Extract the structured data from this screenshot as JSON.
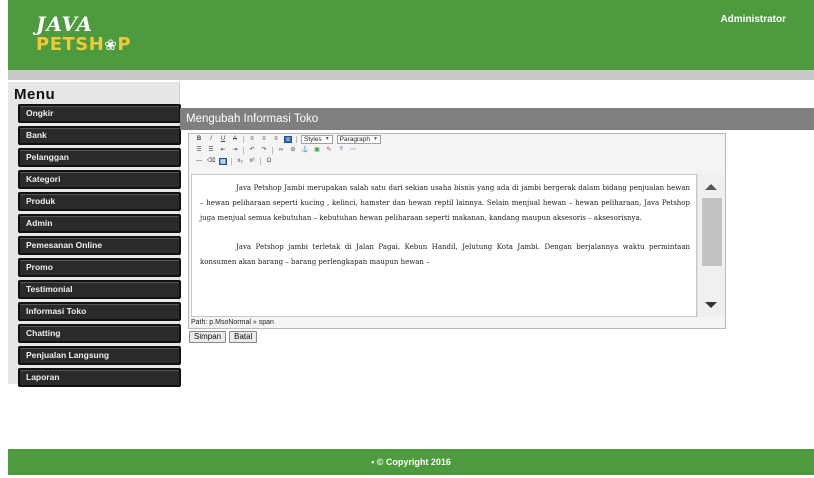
{
  "header": {
    "logo_line1": "JAVA",
    "logo_line2_left": "PETSH",
    "logo_line2_right": "P",
    "admin": "Administrator"
  },
  "sidebar": {
    "title": "Menu",
    "items": [
      {
        "label": "Ongkir"
      },
      {
        "label": "Bank"
      },
      {
        "label": "Pelanggan"
      },
      {
        "label": "Kategori"
      },
      {
        "label": "Produk"
      },
      {
        "label": "Admin"
      },
      {
        "label": "Pemesanan Online"
      },
      {
        "label": "Promo"
      },
      {
        "label": "Testimonial"
      },
      {
        "label": "Informasi Toko"
      },
      {
        "label": "Chatting"
      },
      {
        "label": "Penjualan Langsung"
      },
      {
        "label": "Laporan"
      }
    ]
  },
  "main": {
    "title": "Mengubah Informasi Toko",
    "editor": {
      "styles_select": "Styles",
      "paragraph_select": "Paragraph",
      "paragraph1": "Java Petshop Jambi merupakan salah satu dari sekian usaha bisnis yang ada di jambi bergerak dalam bidang penjualan hewan – hewan peliharaan seperti kucing , kelinci, hamster dan hewan reptil lainnya. Selain menjual hewan – hewan peliharaan, Java Petshop juga menjual semua kebutuhan – kebutuhan hewan peliharaan seperti makanan, kandang maupun aksesoris – aksesorisnya.",
      "paragraph2": "Java Petshop jambi terletak di Jalan Pagai, Kebun Handil, Jelutung Kota Jambi. Dengan berjalannya waktu permintaan konsumen akan barang – barang perlengkapan maupun hewan –",
      "path": "Path: p.MsoNormal » span"
    },
    "buttons": {
      "save": "Simpan",
      "cancel": "Batal"
    }
  },
  "footer": {
    "copyright": "• © Copyright 2016"
  }
}
